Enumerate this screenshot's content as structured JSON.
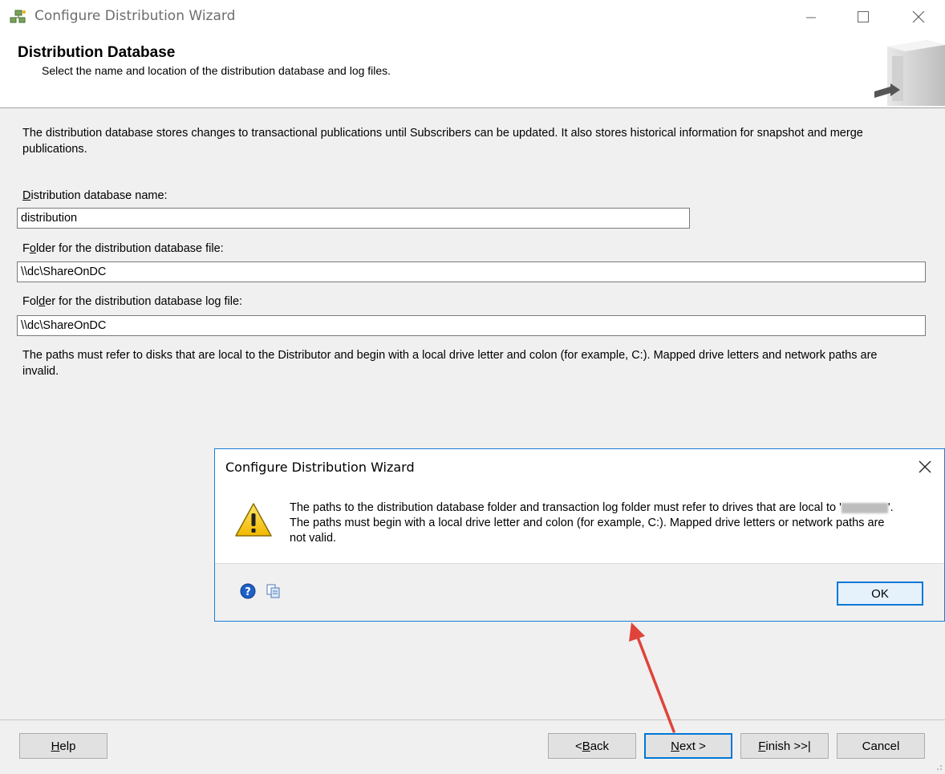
{
  "window": {
    "title": "Configure Distribution Wizard",
    "minimize_icon": "minimize-icon",
    "maximize_icon": "maximize-icon",
    "close_icon": "close-icon"
  },
  "header": {
    "title": "Distribution Database",
    "subtitle": "Select the name and location of the distribution database and log files."
  },
  "main": {
    "intro": "The distribution database stores changes to transactional publications until Subscribers can be updated. It also stores historical information for snapshot and merge publications.",
    "db_name_label": "Distribution database name:",
    "db_name_value": "distribution",
    "db_folder_label": "Folder for the distribution database file:",
    "db_folder_value": "\\\\dc\\ShareOnDC",
    "log_folder_label": "Folder for the distribution database log file:",
    "log_folder_value": "\\\\dc\\ShareOnDC",
    "note": "The paths must refer to disks that are local to the Distributor and begin with a local drive letter and colon (for example, C:). Mapped drive letters and network paths are invalid."
  },
  "dialog": {
    "title": "Configure Distribution Wizard",
    "message_part1": "The paths to the distribution database folder and transaction log folder must refer to drives that are local to '",
    "message_part2": "'. The paths must begin with a local drive letter and colon (for example, C:). Mapped drive letters or network paths are not valid.",
    "ok_label": "OK",
    "icons": [
      "warning-icon",
      "help-icon",
      "copy-icon",
      "close-icon"
    ]
  },
  "footer": {
    "help_label": "Help",
    "back_label": "< Back",
    "next_label": "Next >",
    "finish_label": "Finish >>|",
    "cancel_label": "Cancel"
  },
  "colors": {
    "accent": "#0078d7",
    "arrow": "#e0433a",
    "warning": "#f5c400"
  }
}
